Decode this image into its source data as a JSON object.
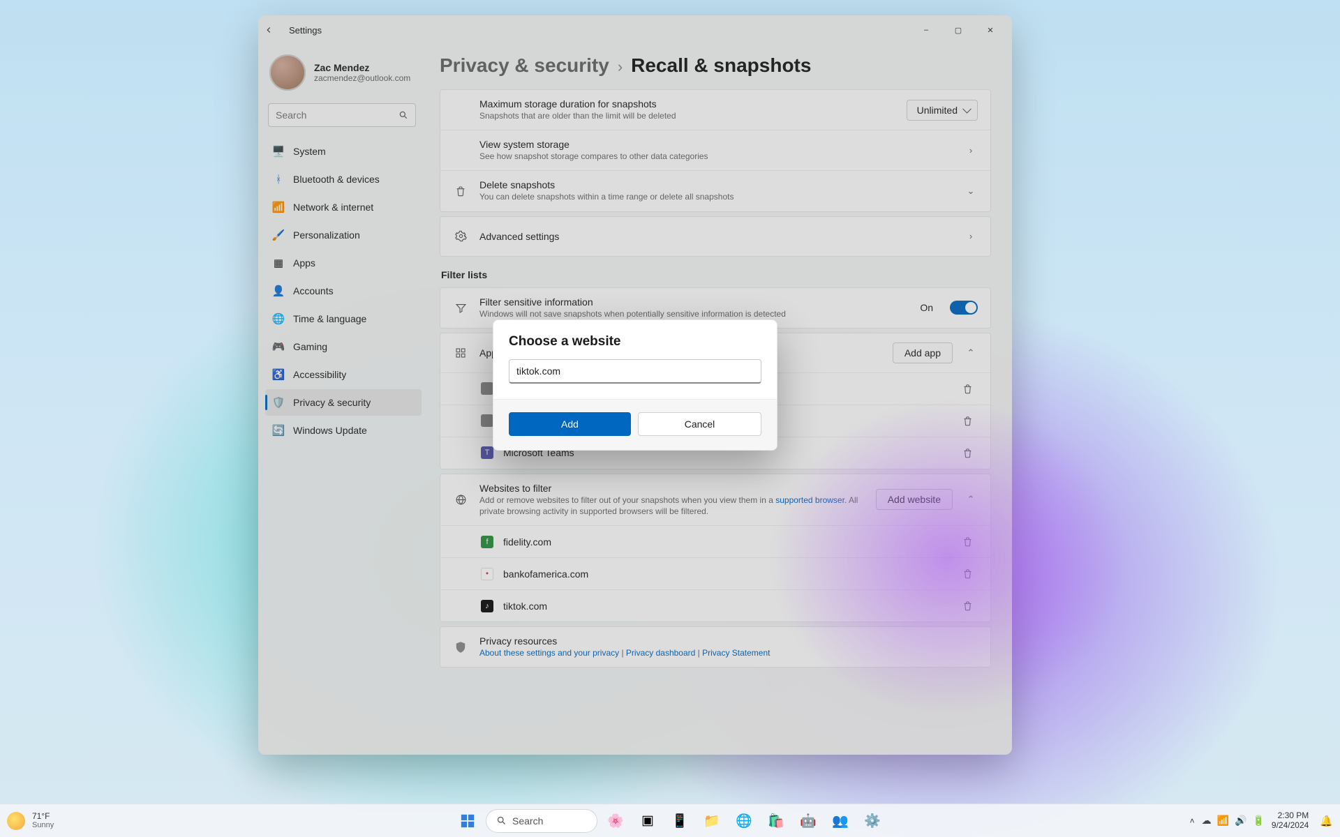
{
  "window": {
    "title": "Settings",
    "controls": {
      "minimize": "–",
      "maximize": "▢",
      "close": "✕"
    }
  },
  "profile": {
    "name": "Zac Mendez",
    "email": "zacmendez@outlook.com"
  },
  "search": {
    "placeholder": "Search"
  },
  "nav": {
    "items": [
      {
        "label": "System",
        "color": "#3a8bdc"
      },
      {
        "label": "Bluetooth & devices",
        "color": "#2d7cd6"
      },
      {
        "label": "Network & internet",
        "color": "#2fa8d8"
      },
      {
        "label": "Personalization",
        "color": "#d98b3a"
      },
      {
        "label": "Apps",
        "color": "#3a6fd6"
      },
      {
        "label": "Accounts",
        "color": "#3fae6f"
      },
      {
        "label": "Time & language",
        "color": "#3a8bdc"
      },
      {
        "label": "Gaming",
        "color": "#3fae9f"
      },
      {
        "label": "Accessibility",
        "color": "#4a8bce"
      },
      {
        "label": "Privacy & security",
        "color": "#7a7a7a",
        "active": true
      },
      {
        "label": "Windows Update",
        "color": "#2b7cd6"
      }
    ]
  },
  "breadcrumb": {
    "parent": "Privacy & security",
    "current": "Recall & snapshots"
  },
  "rows": {
    "maxStorage": {
      "title": "Maximum storage duration for snapshots",
      "sub": "Snapshots that are older than the limit will be deleted",
      "value": "Unlimited"
    },
    "viewStorage": {
      "title": "View system storage",
      "sub": "See how snapshot storage compares to other data categories"
    },
    "deleteSnapshots": {
      "title": "Delete snapshots",
      "sub": "You can delete snapshots within a time range or delete all snapshots"
    },
    "advanced": {
      "title": "Advanced settings"
    }
  },
  "filterSection": {
    "heading": "Filter lists"
  },
  "filterSensitive": {
    "title": "Filter sensitive information",
    "sub": "Windows will not save snapshots when potentially sensitive information is detected",
    "state": "On"
  },
  "appsToFilter": {
    "title": "Apps to filter",
    "addLabel": "Add app",
    "items": [
      {
        "label": ""
      },
      {
        "label": ""
      },
      {
        "label": "Microsoft Teams"
      }
    ]
  },
  "websitesToFilter": {
    "title": "Websites to filter",
    "sub1": "Add or remove websites to filter out of your snapshots when you view them in a ",
    "linkText": "supported browser",
    "sub2": ". All private browsing activity in supported browsers will be filtered.",
    "addLabel": "Add website",
    "items": [
      {
        "label": "fidelity.com",
        "color": "#2e8f3e"
      },
      {
        "label": "bankofamerica.com",
        "color": "#c33a3a"
      },
      {
        "label": "tiktok.com",
        "color": "#111"
      }
    ]
  },
  "privacyResources": {
    "title": "Privacy resources",
    "links": [
      "About these settings and your privacy",
      "Privacy dashboard",
      "Privacy Statement"
    ],
    "sep": " | "
  },
  "modal": {
    "title": "Choose a website",
    "value": "tiktok.com",
    "add": "Add",
    "cancel": "Cancel"
  },
  "taskbar": {
    "weather": {
      "temp": "71°F",
      "cond": "Sunny"
    },
    "search": "Search",
    "tray": {
      "time": "2:30 PM",
      "date": "9/24/2024"
    }
  }
}
